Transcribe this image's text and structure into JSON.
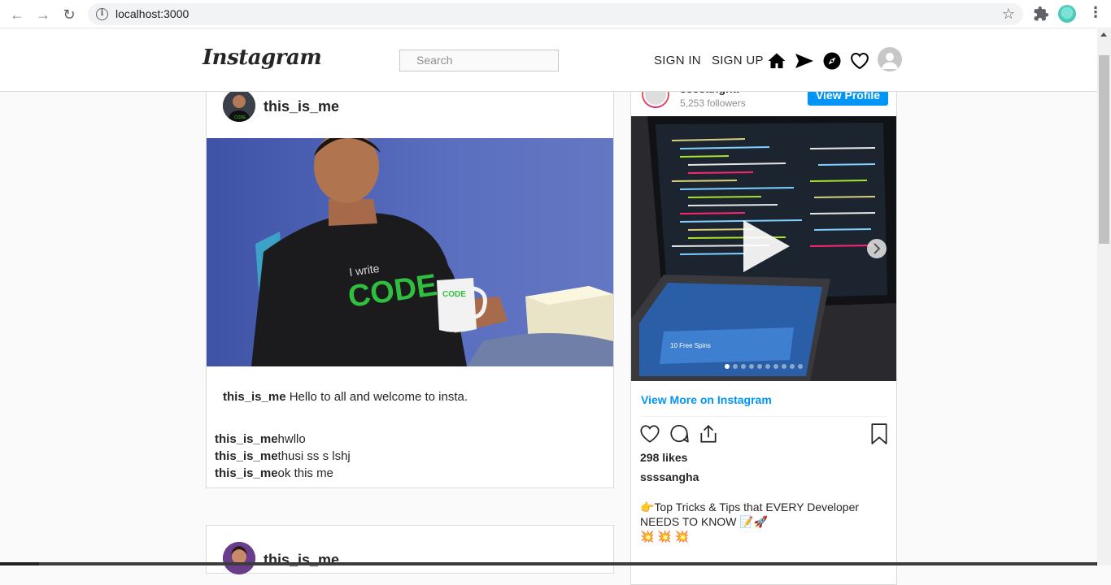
{
  "browser": {
    "url": "localhost:3000"
  },
  "header": {
    "logo": "Instagram",
    "search_placeholder": "Search",
    "sign_in": "SIGN IN",
    "sign_up": "SIGN UP"
  },
  "posts": [
    {
      "username": "this_is_me",
      "caption_user": "this_is_me",
      "caption_text": " Hello to all and welcome to insta.",
      "comments": [
        {
          "user": "this_is_me",
          "text": "hwllo"
        },
        {
          "user": "this_is_me",
          "text": "thusi ss s lshj"
        },
        {
          "user": "this_is_me",
          "text": "ok this me"
        }
      ]
    },
    {
      "username": "this_is_me"
    }
  ],
  "embed": {
    "username_top": "ssssangha",
    "followers": "5,253 followers",
    "view_profile": "View Profile",
    "view_more": "View More on Instagram",
    "likes": "298 likes",
    "username": "ssssangha",
    "caption_line1": "👉Top Tricks & Tips that EVERY Developer",
    "caption_line2": "NEEDS TO KNOW 📝🚀",
    "caption_line3": "💥 💥 💥",
    "carousel_dots": 10,
    "carousel_active": 1
  },
  "colors": {
    "accent": "#0095f6",
    "text": "#262626",
    "muted": "#8e8e8e"
  }
}
